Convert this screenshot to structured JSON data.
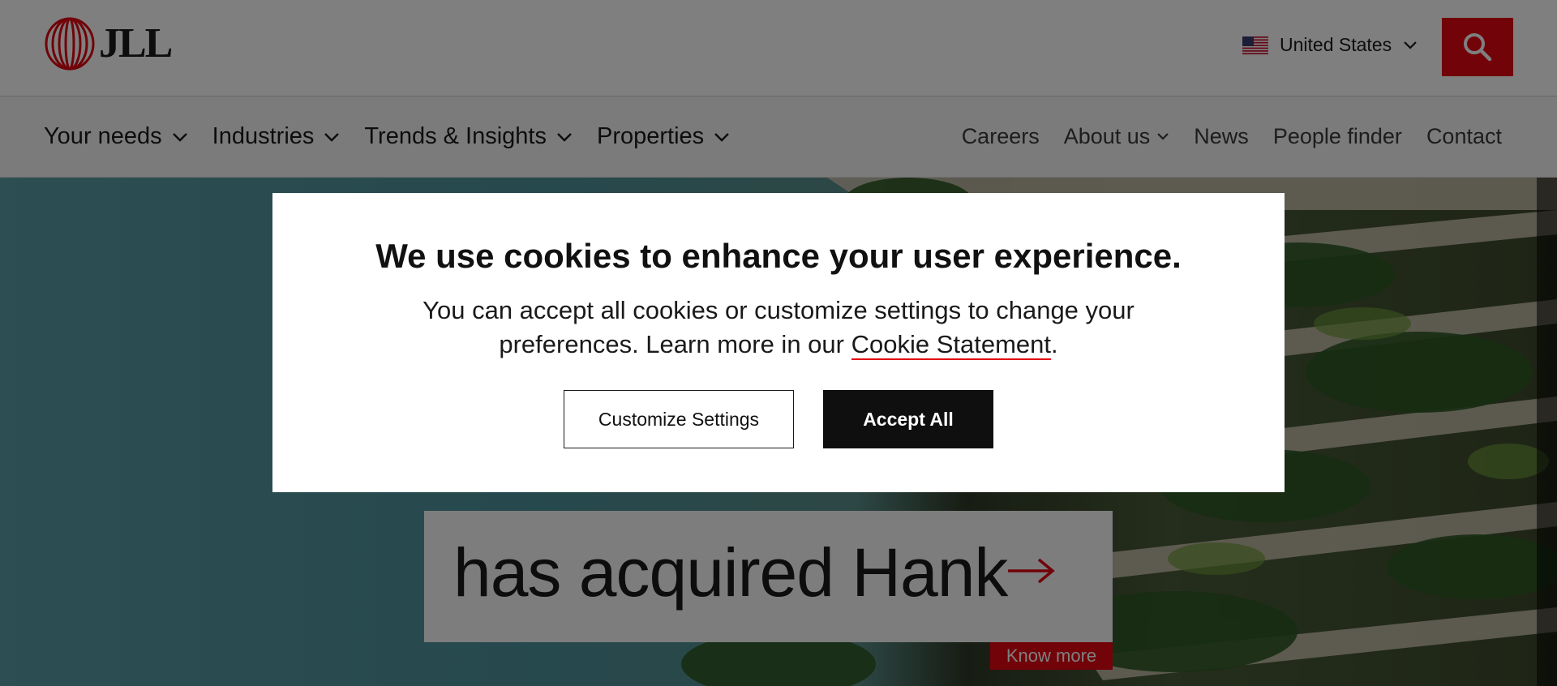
{
  "brand": {
    "logo_text": "JLL",
    "accent_color": "#e30613"
  },
  "header": {
    "locale_label": "United States",
    "flag_icon": "us-flag-icon",
    "search_icon": "search-icon"
  },
  "nav": {
    "main_items": [
      {
        "label": "Your needs"
      },
      {
        "label": "Industries"
      },
      {
        "label": "Trends & Insights"
      },
      {
        "label": "Properties"
      }
    ],
    "utility_links": [
      {
        "label": "Careers"
      },
      {
        "label": "About us"
      },
      {
        "label": "News"
      },
      {
        "label": "People finder"
      },
      {
        "label": "Contact"
      }
    ]
  },
  "hero": {
    "headline": "has acquired Hank",
    "cta_label": "Know more"
  },
  "cookie_modal": {
    "title": "We use cookies to enhance your user experience.",
    "body_prefix": "You can accept all cookies or customize settings to change your preferences. Learn more in our ",
    "link_label": "Cookie Statement",
    "body_suffix": ".",
    "customize_label": "Customize Settings",
    "accept_label": "Accept All"
  }
}
